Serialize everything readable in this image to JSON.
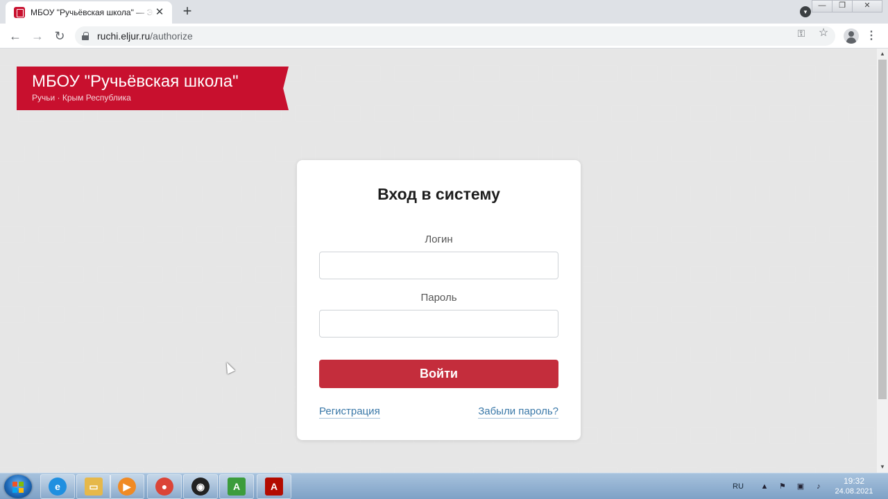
{
  "browser": {
    "tab_title": "МБОУ \"Ручьёвская школа\" — Эл",
    "tab_close": "✕",
    "new_tab": "+",
    "url_host": "ruchi.eljur.ru",
    "url_path": "/authorize",
    "icons": {
      "back": "arrow-left-icon",
      "forward": "arrow-right-icon",
      "reload": "reload-icon",
      "key": "key-icon",
      "star": "star-icon",
      "profile": "profile-icon",
      "menu": "kebab-menu-icon",
      "tab_search": "tab-search-icon"
    }
  },
  "banner": {
    "title": "МБОУ \"Ручьёвская школа\"",
    "subtitle": "Ручьи · Крым Республика",
    "color": "#c8102e"
  },
  "login": {
    "title": "Вход в систему",
    "login_label": "Логин",
    "login_value": "",
    "password_label": "Пароль",
    "password_value": "",
    "submit_label": "Войти",
    "register_link": "Регистрация",
    "forgot_link": "Забыли пароль?",
    "button_color": "#c42d3c",
    "link_color": "#3a78a8"
  },
  "taskbar": {
    "language": "RU",
    "time": "19:32",
    "date": "24.08.2021",
    "apps": [
      {
        "name": "internet-explorer",
        "glyph": "e",
        "color": "#1f8fe0"
      },
      {
        "name": "file-explorer",
        "glyph": "▭",
        "color": "#e6b84a"
      },
      {
        "name": "media-player",
        "glyph": "▶",
        "color": "#f08a24"
      },
      {
        "name": "chrome",
        "glyph": "●",
        "color": "#db4437"
      },
      {
        "name": "obs-studio",
        "glyph": "◉",
        "color": "#222222"
      },
      {
        "name": "adobe-acrobat-reader-ap",
        "glyph": "A",
        "color": "#3c9c3c"
      },
      {
        "name": "adobe-acrobat",
        "glyph": "A",
        "color": "#b30b00"
      }
    ]
  }
}
